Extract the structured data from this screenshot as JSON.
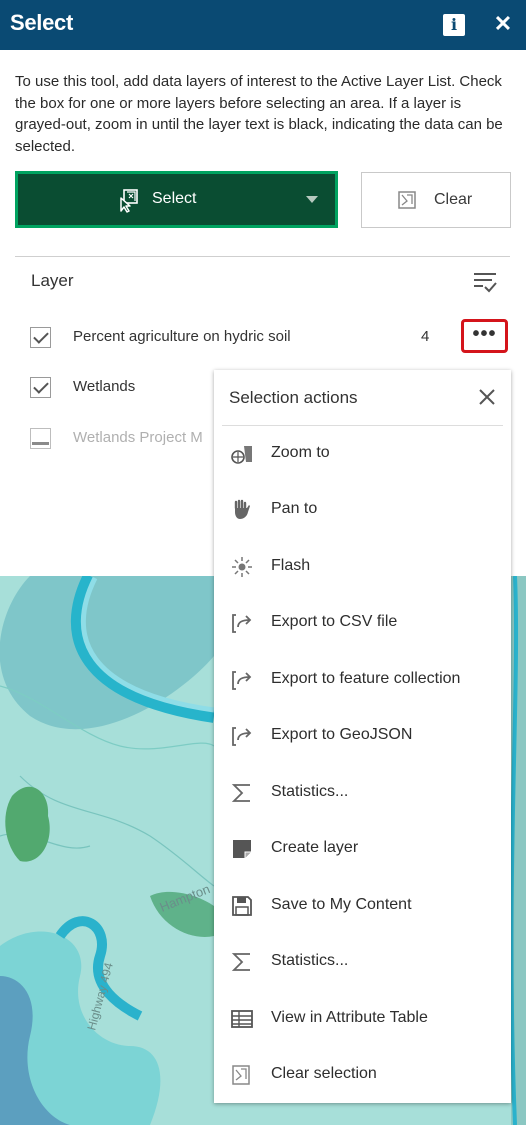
{
  "header": {
    "title": "Select",
    "info_icon": "info-icon",
    "close_icon": "close-icon"
  },
  "description": "To use this tool, add data layers of interest to the Active Layer List. Check the box for one or more layers before selecting an area. If a layer is grayed-out, zoom in until the layer text is black, indicating the data can be selected.",
  "buttons": {
    "select_label": "Select",
    "clear_label": "Clear"
  },
  "layers": {
    "heading": "Layer",
    "items": [
      {
        "name": "Percent agriculture on hydric soil",
        "count": "4",
        "checked": true
      },
      {
        "name": "Wetlands",
        "count": "",
        "checked": true
      },
      {
        "name": "Wetlands Project M",
        "count": "",
        "checked": false,
        "disabled": true
      }
    ]
  },
  "more_label": "•••",
  "popup": {
    "title": "Selection actions",
    "actions": [
      {
        "label": "Zoom to",
        "icon": "zoom-to-icon"
      },
      {
        "label": "Pan to",
        "icon": "pan-hand-icon"
      },
      {
        "label": "Flash",
        "icon": "flash-icon"
      },
      {
        "label": "Export to CSV file",
        "icon": "export-icon"
      },
      {
        "label": "Export to feature collection",
        "icon": "export-icon"
      },
      {
        "label": "Export to GeoJSON",
        "icon": "export-icon"
      },
      {
        "label": "Statistics...",
        "icon": "sigma-icon"
      },
      {
        "label": "Create layer",
        "icon": "create-layer-icon"
      },
      {
        "label": "Save to My Content",
        "icon": "save-icon"
      },
      {
        "label": "Statistics...",
        "icon": "sigma-icon"
      },
      {
        "label": "View in Attribute Table",
        "icon": "table-icon"
      },
      {
        "label": "Clear selection",
        "icon": "clear-selection-icon"
      }
    ]
  },
  "map": {
    "labels": [
      "Hampton",
      "Highway 494"
    ]
  },
  "colors": {
    "header": "#0a4a73",
    "select_button": "#0a4d32",
    "highlight": "#d4141b",
    "map_base": "#a7dfd9",
    "water": "#5aaecd",
    "wetland": "#4fb07a"
  }
}
